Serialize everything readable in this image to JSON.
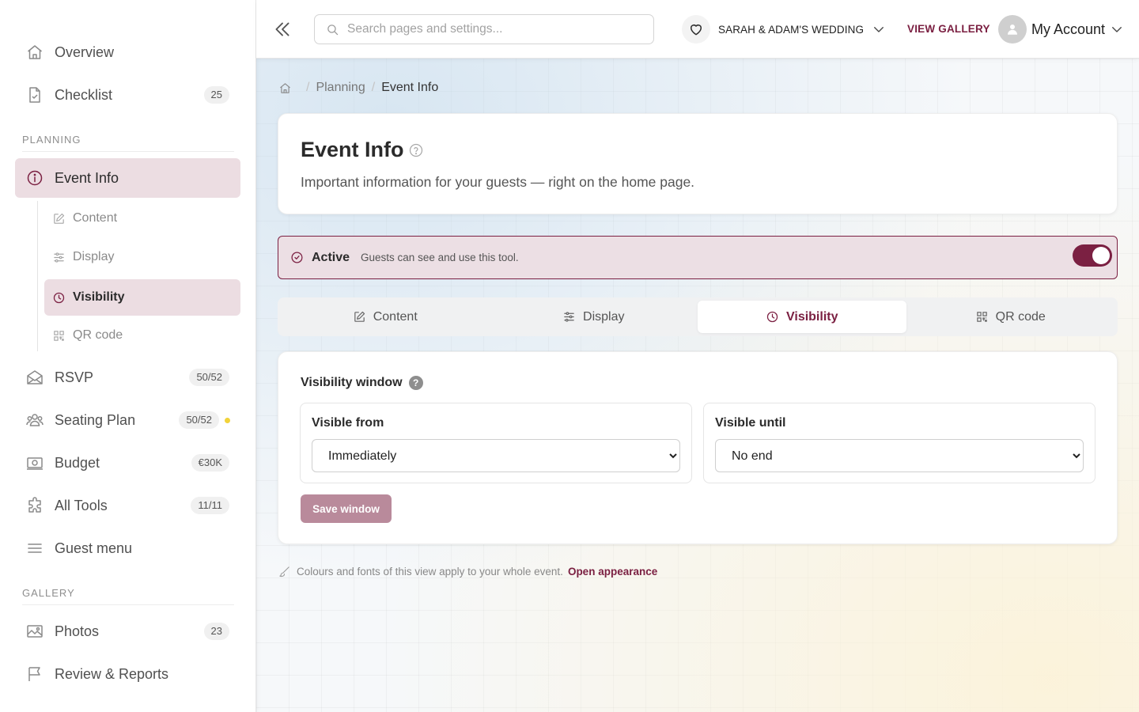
{
  "theme": {
    "accent": "#7b2042",
    "accent_soft": "#ecdde2",
    "save_disabled": "#b98a9b",
    "status_dot": "#f2d33a"
  },
  "sidebar": {
    "overview": {
      "label": "Overview",
      "icon": "home-icon"
    },
    "checklist": {
      "label": "Checklist",
      "badge": "25",
      "icon": "document-check-icon"
    },
    "planning_label": "PLANNING",
    "event_info": {
      "label": "Event Info",
      "icon": "info-icon"
    },
    "sub_items": [
      {
        "label": "Content",
        "icon": "edit-icon"
      },
      {
        "label": "Display",
        "icon": "sliders-icon"
      },
      {
        "label": "Visibility",
        "icon": "clock-icon"
      },
      {
        "label": "QR code",
        "icon": "qr-code-icon"
      }
    ],
    "rsvp": {
      "label": "RSVP",
      "badge": "50/52",
      "icon": "envelope-open-icon"
    },
    "seating": {
      "label": "Seating Plan",
      "badge": "50/52",
      "icon": "people-icon"
    },
    "budget": {
      "label": "Budget",
      "badge": "€30K",
      "icon": "money-icon"
    },
    "all_tools": {
      "label": "All Tools",
      "badge": "11/11",
      "icon": "puzzle-icon"
    },
    "guest_menu": {
      "label": "Guest menu",
      "icon": "menu-icon"
    },
    "gallery_label": "GALLERY",
    "photos": {
      "label": "Photos",
      "badge": "23",
      "icon": "image-icon"
    },
    "review": {
      "label": "Review & Reports",
      "icon": "flag-icon"
    }
  },
  "topbar": {
    "search_placeholder": "Search pages and settings...",
    "search_value": "",
    "event_name": "SARAH & ADAM'S WEDDING",
    "view_gallery": "VIEW GALLERY",
    "account_label": "My Account"
  },
  "breadcrumb": {
    "items": [
      "Planning",
      "Event Info"
    ]
  },
  "header": {
    "title": "Event Info",
    "subtitle": "Important information for your guests — right on the home page."
  },
  "status": {
    "title": "Active",
    "description": "Guests can see and use this tool.",
    "toggle_on": true
  },
  "tabs": [
    {
      "label": "Content",
      "icon": "edit-icon"
    },
    {
      "label": "Display",
      "icon": "sliders-icon"
    },
    {
      "label": "Visibility",
      "icon": "clock-icon",
      "active": true
    },
    {
      "label": "QR code",
      "icon": "qr-code-icon"
    }
  ],
  "visibility": {
    "title": "Visibility window",
    "help": "?",
    "from_label": "Visible from",
    "from_value": "Immediately",
    "until_label": "Visible until",
    "until_value": "No end",
    "save_label": "Save window"
  },
  "footnote": {
    "text": "Colours and fonts of this view apply to your whole event.",
    "link": "Open appearance"
  }
}
